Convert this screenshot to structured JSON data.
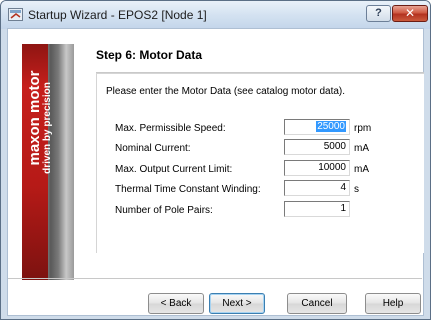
{
  "window": {
    "title": "Startup Wizard - EPOS2 [Node 1]",
    "help_label": "?",
    "close_label": "✕"
  },
  "banner": {
    "brand": "maxon motor",
    "tagline": "driven by precision",
    "brand_color": "#c61f1c"
  },
  "step": {
    "title": "Step 6: Motor Data",
    "instruction": "Please enter the Motor Data (see catalog motor data)."
  },
  "fields": [
    {
      "label": "Max. Permissible Speed:",
      "value": "25000",
      "unit": "rpm",
      "selected": true
    },
    {
      "label": "Nominal Current:",
      "value": "5000",
      "unit": "mA"
    },
    {
      "label": "Max. Output Current Limit:",
      "value": "10000",
      "unit": "mA"
    },
    {
      "label": "Thermal Time Constant Winding:",
      "value": "4",
      "unit": "s"
    },
    {
      "label": "Number of Pole Pairs:",
      "value": "1",
      "unit": ""
    }
  ],
  "buttons": {
    "back": "< Back",
    "next": "Next >",
    "cancel": "Cancel",
    "help": "Help"
  }
}
